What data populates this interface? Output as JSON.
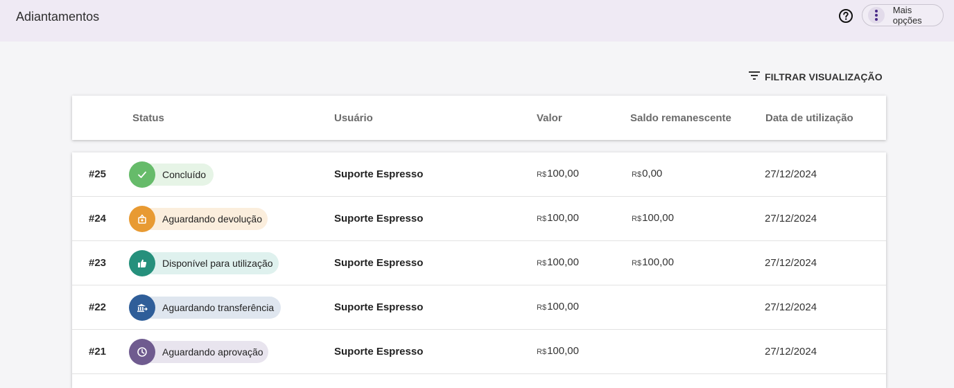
{
  "header": {
    "title": "Adiantamentos",
    "help_icon": "help-circle-icon",
    "more_label": "Mais opções",
    "more_icon": "more-vertical-icon"
  },
  "toolbar": {
    "filter_label": "FILTRAR VISUALIZAÇÃO",
    "filter_icon": "filter-list-icon"
  },
  "table": {
    "columns": {
      "status": "Status",
      "user": "Usuário",
      "value": "Valor",
      "balance": "Saldo remanescente",
      "date": "Data de utilização"
    },
    "rows": [
      {
        "id": "#25",
        "status": "Concluído",
        "status_icon": "check-icon",
        "icon_color": "#66bb6a",
        "chip_color": "#e6f4e6",
        "user": "Suporte Espresso",
        "currency": "R$",
        "value": "100,00",
        "balance_currency": "R$",
        "balance": "0,00",
        "date": "27/12/2024"
      },
      {
        "id": "#24",
        "status": "Aguardando devolução",
        "status_icon": "money-return-icon",
        "icon_color": "#e89a32",
        "chip_color": "#fbeedd",
        "user": "Suporte Espresso",
        "currency": "R$",
        "value": "100,00",
        "balance_currency": "R$",
        "balance": "100,00",
        "date": "27/12/2024"
      },
      {
        "id": "#23",
        "status": "Disponível para utilização",
        "status_icon": "thumb-up-icon",
        "icon_color": "#26907c",
        "chip_color": "#dff1ee",
        "user": "Suporte Espresso",
        "currency": "R$",
        "value": "100,00",
        "balance_currency": "R$",
        "balance": "100,00",
        "date": "27/12/2024"
      },
      {
        "id": "#22",
        "status": "Aguardando transferência",
        "status_icon": "bank-transfer-icon",
        "icon_color": "#2f5e99",
        "chip_color": "#dfe6ef",
        "user": "Suporte Espresso",
        "currency": "R$",
        "value": "100,00",
        "balance_currency": "",
        "balance": "",
        "date": "27/12/2024"
      },
      {
        "id": "#21",
        "status": "Aguardando aprovação",
        "status_icon": "clock-icon",
        "icon_color": "#6f5b8f",
        "chip_color": "#e8e4ee",
        "user": "Suporte Espresso",
        "currency": "R$",
        "value": "100,00",
        "balance_currency": "",
        "balance": "",
        "date": "27/12/2024"
      }
    ]
  }
}
